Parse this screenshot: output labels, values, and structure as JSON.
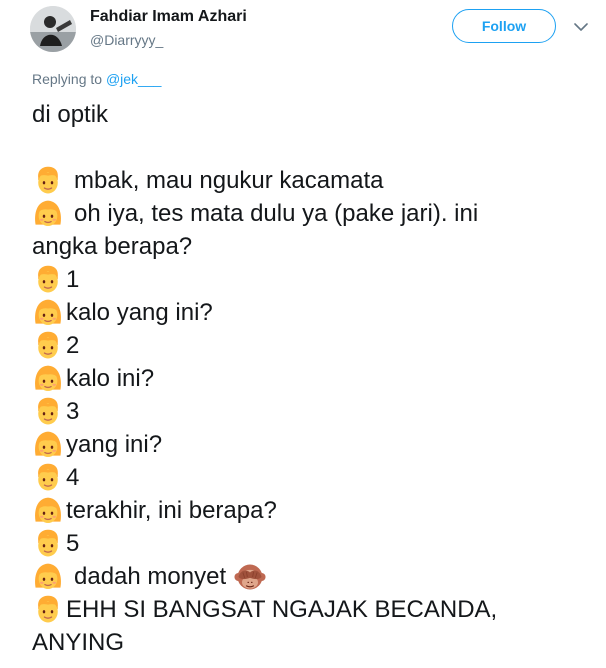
{
  "header": {
    "display_name": "Fahdiar Imam Azhari",
    "handle": "@Diarryyy_",
    "follow_label": "Follow"
  },
  "reply": {
    "prefix": "Replying to ",
    "mention": "@jek___"
  },
  "tweet": {
    "lines": [
      {
        "emoji": null,
        "text": "di optik"
      },
      {
        "emoji": null,
        "text": ""
      },
      {
        "emoji": "boy-emoji",
        "text": "mbak, mau ngukur kacamata"
      },
      {
        "emoji": "girl-emoji",
        "text": "oh iya, tes mata dulu ya (pake jari). ini"
      },
      {
        "emoji": null,
        "text": "angka berapa?"
      },
      {
        "emoji": "boy-emoji",
        "text": "1"
      },
      {
        "emoji": "girl-emoji",
        "text": "kalo yang ini?"
      },
      {
        "emoji": "boy-emoji",
        "text": "2"
      },
      {
        "emoji": "girl-emoji",
        "text": "kalo ini?"
      },
      {
        "emoji": "boy-emoji",
        "text": "3"
      },
      {
        "emoji": "girl-emoji",
        "text": "yang ini?"
      },
      {
        "emoji": "boy-emoji",
        "text": "4"
      },
      {
        "emoji": "girl-emoji",
        "text": "terakhir, ini berapa?"
      },
      {
        "emoji": "boy-emoji",
        "text": "5"
      },
      {
        "emoji": "girl-emoji",
        "text": "dadah monyet",
        "trailing_emoji": "see-no-evil-monkey-emoji"
      },
      {
        "emoji": "boy-emoji",
        "text": "EHH SI BANGSAT NGAJAK BECANDA,"
      },
      {
        "emoji": null,
        "text": "ANYING"
      }
    ]
  },
  "colors": {
    "text": "#14171a",
    "secondary": "#657786",
    "accent": "#1da1f2",
    "emoji_face": "#ffcc4d",
    "emoji_hair": "#ffac33"
  }
}
